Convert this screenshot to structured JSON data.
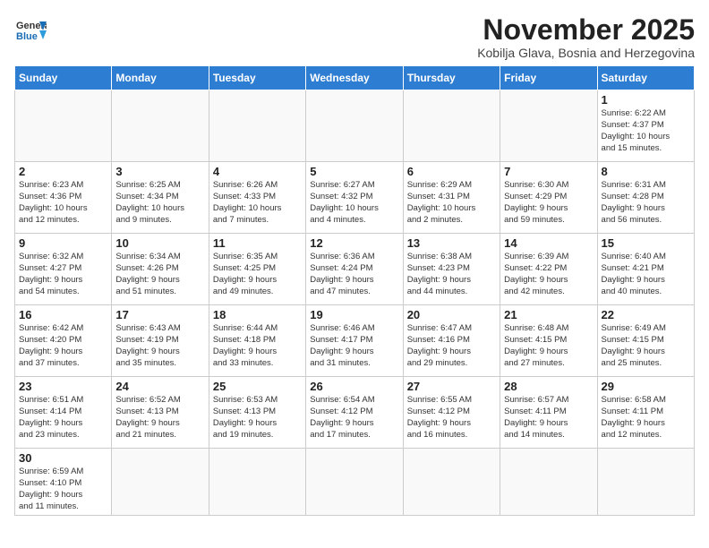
{
  "header": {
    "logo_general": "General",
    "logo_blue": "Blue",
    "title": "November 2025",
    "subtitle": "Kobilja Glava, Bosnia and Herzegovina"
  },
  "weekdays": [
    "Sunday",
    "Monday",
    "Tuesday",
    "Wednesday",
    "Thursday",
    "Friday",
    "Saturday"
  ],
  "weeks": [
    [
      {
        "day": "",
        "info": ""
      },
      {
        "day": "",
        "info": ""
      },
      {
        "day": "",
        "info": ""
      },
      {
        "day": "",
        "info": ""
      },
      {
        "day": "",
        "info": ""
      },
      {
        "day": "",
        "info": ""
      },
      {
        "day": "1",
        "info": "Sunrise: 6:22 AM\nSunset: 4:37 PM\nDaylight: 10 hours\nand 15 minutes."
      }
    ],
    [
      {
        "day": "2",
        "info": "Sunrise: 6:23 AM\nSunset: 4:36 PM\nDaylight: 10 hours\nand 12 minutes."
      },
      {
        "day": "3",
        "info": "Sunrise: 6:25 AM\nSunset: 4:34 PM\nDaylight: 10 hours\nand 9 minutes."
      },
      {
        "day": "4",
        "info": "Sunrise: 6:26 AM\nSunset: 4:33 PM\nDaylight: 10 hours\nand 7 minutes."
      },
      {
        "day": "5",
        "info": "Sunrise: 6:27 AM\nSunset: 4:32 PM\nDaylight: 10 hours\nand 4 minutes."
      },
      {
        "day": "6",
        "info": "Sunrise: 6:29 AM\nSunset: 4:31 PM\nDaylight: 10 hours\nand 2 minutes."
      },
      {
        "day": "7",
        "info": "Sunrise: 6:30 AM\nSunset: 4:29 PM\nDaylight: 9 hours\nand 59 minutes."
      },
      {
        "day": "8",
        "info": "Sunrise: 6:31 AM\nSunset: 4:28 PM\nDaylight: 9 hours\nand 56 minutes."
      }
    ],
    [
      {
        "day": "9",
        "info": "Sunrise: 6:32 AM\nSunset: 4:27 PM\nDaylight: 9 hours\nand 54 minutes."
      },
      {
        "day": "10",
        "info": "Sunrise: 6:34 AM\nSunset: 4:26 PM\nDaylight: 9 hours\nand 51 minutes."
      },
      {
        "day": "11",
        "info": "Sunrise: 6:35 AM\nSunset: 4:25 PM\nDaylight: 9 hours\nand 49 minutes."
      },
      {
        "day": "12",
        "info": "Sunrise: 6:36 AM\nSunset: 4:24 PM\nDaylight: 9 hours\nand 47 minutes."
      },
      {
        "day": "13",
        "info": "Sunrise: 6:38 AM\nSunset: 4:23 PM\nDaylight: 9 hours\nand 44 minutes."
      },
      {
        "day": "14",
        "info": "Sunrise: 6:39 AM\nSunset: 4:22 PM\nDaylight: 9 hours\nand 42 minutes."
      },
      {
        "day": "15",
        "info": "Sunrise: 6:40 AM\nSunset: 4:21 PM\nDaylight: 9 hours\nand 40 minutes."
      }
    ],
    [
      {
        "day": "16",
        "info": "Sunrise: 6:42 AM\nSunset: 4:20 PM\nDaylight: 9 hours\nand 37 minutes."
      },
      {
        "day": "17",
        "info": "Sunrise: 6:43 AM\nSunset: 4:19 PM\nDaylight: 9 hours\nand 35 minutes."
      },
      {
        "day": "18",
        "info": "Sunrise: 6:44 AM\nSunset: 4:18 PM\nDaylight: 9 hours\nand 33 minutes."
      },
      {
        "day": "19",
        "info": "Sunrise: 6:46 AM\nSunset: 4:17 PM\nDaylight: 9 hours\nand 31 minutes."
      },
      {
        "day": "20",
        "info": "Sunrise: 6:47 AM\nSunset: 4:16 PM\nDaylight: 9 hours\nand 29 minutes."
      },
      {
        "day": "21",
        "info": "Sunrise: 6:48 AM\nSunset: 4:15 PM\nDaylight: 9 hours\nand 27 minutes."
      },
      {
        "day": "22",
        "info": "Sunrise: 6:49 AM\nSunset: 4:15 PM\nDaylight: 9 hours\nand 25 minutes."
      }
    ],
    [
      {
        "day": "23",
        "info": "Sunrise: 6:51 AM\nSunset: 4:14 PM\nDaylight: 9 hours\nand 23 minutes."
      },
      {
        "day": "24",
        "info": "Sunrise: 6:52 AM\nSunset: 4:13 PM\nDaylight: 9 hours\nand 21 minutes."
      },
      {
        "day": "25",
        "info": "Sunrise: 6:53 AM\nSunset: 4:13 PM\nDaylight: 9 hours\nand 19 minutes."
      },
      {
        "day": "26",
        "info": "Sunrise: 6:54 AM\nSunset: 4:12 PM\nDaylight: 9 hours\nand 17 minutes."
      },
      {
        "day": "27",
        "info": "Sunrise: 6:55 AM\nSunset: 4:12 PM\nDaylight: 9 hours\nand 16 minutes."
      },
      {
        "day": "28",
        "info": "Sunrise: 6:57 AM\nSunset: 4:11 PM\nDaylight: 9 hours\nand 14 minutes."
      },
      {
        "day": "29",
        "info": "Sunrise: 6:58 AM\nSunset: 4:11 PM\nDaylight: 9 hours\nand 12 minutes."
      }
    ],
    [
      {
        "day": "30",
        "info": "Sunrise: 6:59 AM\nSunset: 4:10 PM\nDaylight: 9 hours\nand 11 minutes."
      },
      {
        "day": "",
        "info": ""
      },
      {
        "day": "",
        "info": ""
      },
      {
        "day": "",
        "info": ""
      },
      {
        "day": "",
        "info": ""
      },
      {
        "day": "",
        "info": ""
      },
      {
        "day": "",
        "info": ""
      }
    ]
  ]
}
